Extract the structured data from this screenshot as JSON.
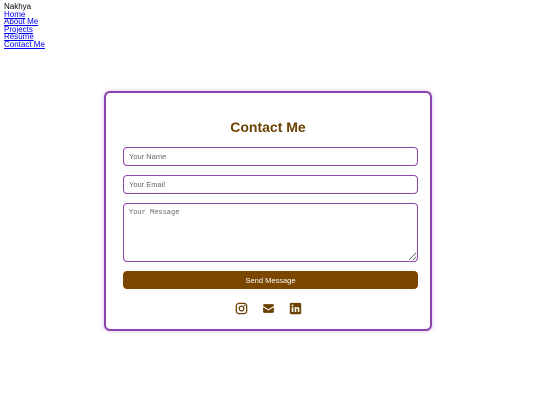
{
  "nav": {
    "brand": "Nakhya",
    "links": [
      "Home",
      "About Me",
      "Projects",
      "Resume",
      "Contact Me"
    ]
  },
  "contact": {
    "title": "Contact Me",
    "name_placeholder": "Your Name",
    "email_placeholder": "Your Email",
    "message_placeholder": "Your Message",
    "send_label": "Send Message"
  },
  "socials": {
    "icons": [
      "instagram-icon",
      "envelope-icon",
      "linkedin-icon"
    ]
  },
  "colors": {
    "accent_border": "#8e44ad",
    "brand_brown": "#6b4000",
    "button_bg": "#7a4600",
    "link": "#0000ee"
  }
}
